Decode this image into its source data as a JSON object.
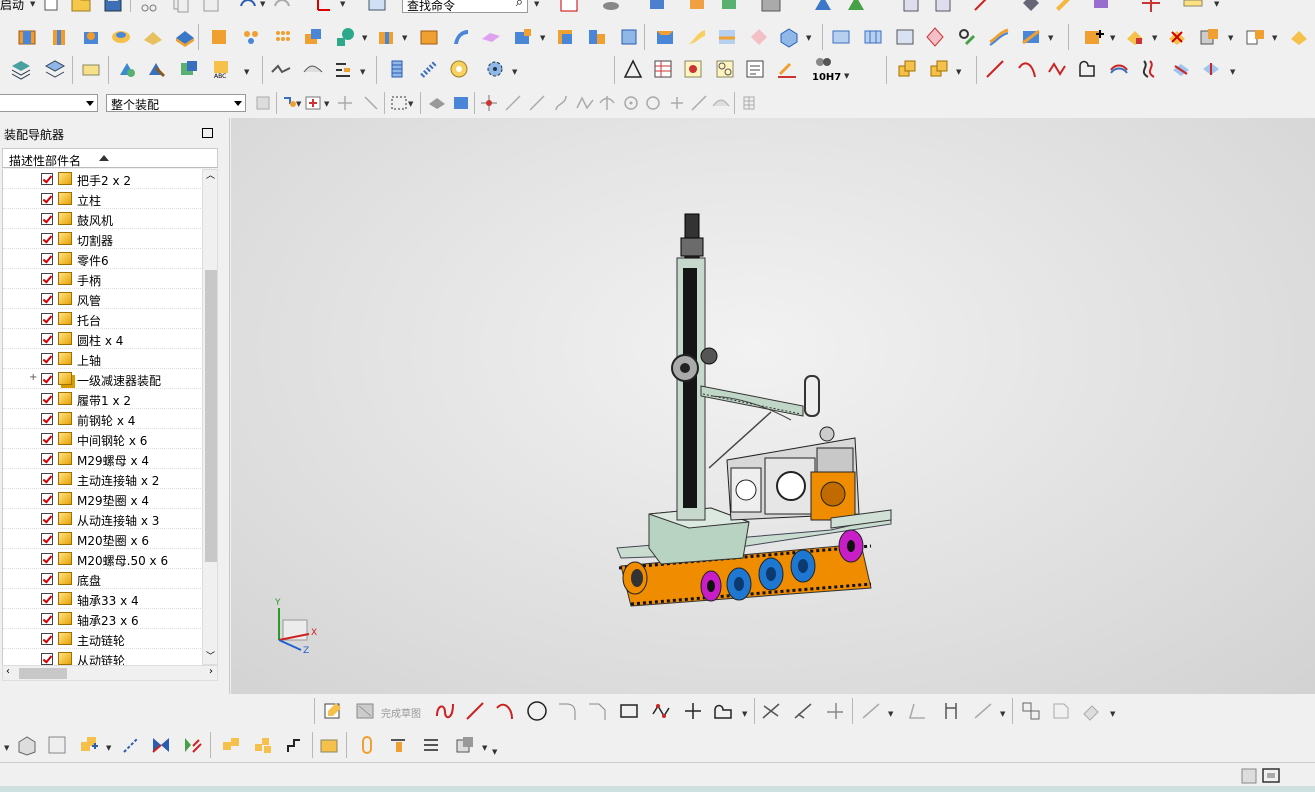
{
  "toolbar": {
    "start_label": "启动",
    "command_search_placeholder": "查找命令",
    "filter_combo_value": "",
    "scope_combo_value": "整个装配",
    "sketch_finish_label": "完成草图",
    "fit_tag": "10H7"
  },
  "navigator": {
    "title": "装配导航器",
    "column_header": "描述性部件名",
    "items": [
      {
        "label": "把手2 x 2",
        "assembly": false
      },
      {
        "label": "立柱",
        "assembly": false
      },
      {
        "label": "鼓风机",
        "assembly": false
      },
      {
        "label": "切割器",
        "assembly": false
      },
      {
        "label": "零件6",
        "assembly": false
      },
      {
        "label": "手柄",
        "assembly": false
      },
      {
        "label": "风管",
        "assembly": false
      },
      {
        "label": "托台",
        "assembly": false
      },
      {
        "label": "圆柱 x 4",
        "assembly": false
      },
      {
        "label": "上轴",
        "assembly": false
      },
      {
        "label": "一级减速器装配",
        "assembly": true
      },
      {
        "label": "履带1 x 2",
        "assembly": false
      },
      {
        "label": "前钢轮 x 4",
        "assembly": false
      },
      {
        "label": "中间钢轮 x 6",
        "assembly": false
      },
      {
        "label": "M29螺母 x 4",
        "assembly": false
      },
      {
        "label": "主动连接轴 x 2",
        "assembly": false
      },
      {
        "label": "M29垫圈 x 4",
        "assembly": false
      },
      {
        "label": "从动连接轴 x 3",
        "assembly": false
      },
      {
        "label": "M20垫圈 x 6",
        "assembly": false
      },
      {
        "label": "M20螺母.50 x 6",
        "assembly": false
      },
      {
        "label": "底盘",
        "assembly": false
      },
      {
        "label": "轴承33 x 4",
        "assembly": false
      },
      {
        "label": "轴承23 x 6",
        "assembly": false
      },
      {
        "label": "主动链轮",
        "assembly": false
      },
      {
        "label": "从动链轮",
        "assembly": false
      }
    ]
  },
  "viewport": {
    "triad_x": "X",
    "triad_y": "Y",
    "triad_z": "Z"
  },
  "colors": {
    "accent_red": "#d00000",
    "part_gold": "#e7a300",
    "model_green": "#b9d3c2",
    "track_orange": "#f08c00",
    "wheel_blue": "#1e78d2",
    "wheel_magenta": "#c81ec8"
  }
}
